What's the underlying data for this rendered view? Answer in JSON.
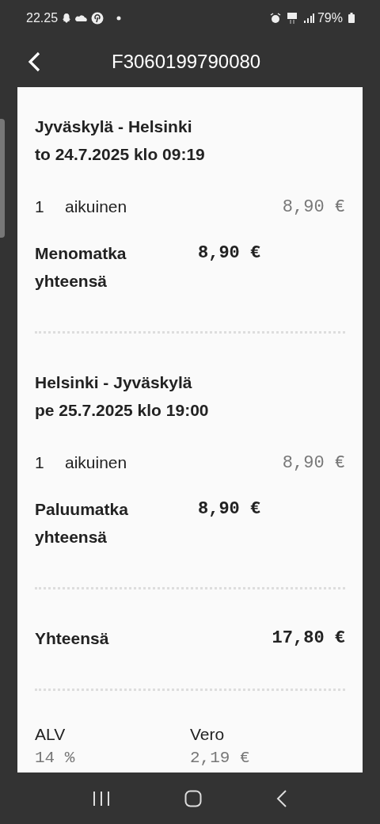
{
  "status_bar": {
    "time": "22.25",
    "battery": "79%"
  },
  "header": {
    "title": "F3060199790080"
  },
  "trips": [
    {
      "route": "Jyväskylä - Helsinki",
      "departure": "to 24.7.2025 klo 09:19",
      "lines": [
        {
          "count": "1",
          "type": "aikuinen",
          "price": "8,90 €"
        }
      ],
      "subtotal_label": "Menomatka yhteensä",
      "subtotal": "8,90 €"
    },
    {
      "route": "Helsinki - Jyväskylä",
      "departure": "pe 25.7.2025 klo 19:00",
      "lines": [
        {
          "count": "1",
          "type": "aikuinen",
          "price": "8,90 €"
        }
      ],
      "subtotal_label": "Paluumatka yhteensä",
      "subtotal": "8,90 €"
    }
  ],
  "total": {
    "label": "Yhteensä",
    "value": "17,80 €"
  },
  "vat": [
    {
      "label": "ALV",
      "value": "14 %"
    },
    {
      "label": "Vero",
      "value": "2,19 €"
    }
  ]
}
